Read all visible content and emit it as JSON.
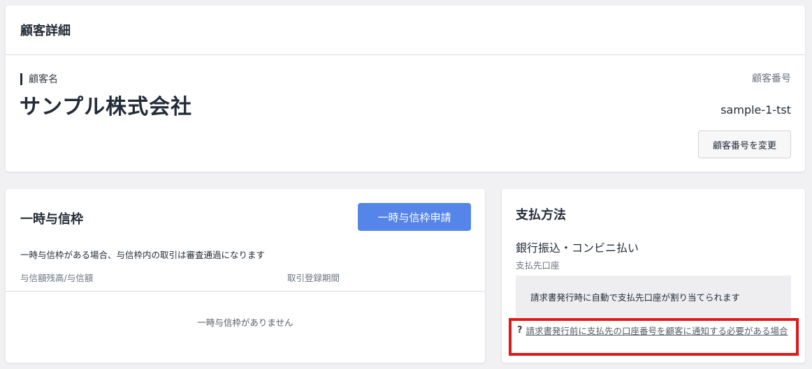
{
  "customer_detail": {
    "title": "顧客詳細",
    "name_label": "顧客名",
    "name": "サンプル株式会社",
    "number_label": "顧客番号",
    "number_value": "sample-1-tst",
    "change_number_button": "顧客番号を変更"
  },
  "temporary_credit": {
    "title": "一時与信枠",
    "apply_button": "一時与信枠申請",
    "description": "一時与信枠がある場合、与信枠内の取引は審査通過になります",
    "columns": [
      "与信額残高/与信額",
      "取引登録期間"
    ],
    "empty_message": "一時与信枠がありません",
    "accent_color": "#5585e8"
  },
  "payment_method": {
    "title": "支払方法",
    "method": "銀行振込・コンビニ払い",
    "account_label": "支払先口座",
    "auto_assign_note": "請求書発行時に自動で支払先口座が割り当てられます",
    "help_icon": "question-icon",
    "help_link": "請求書発行前に支払先の口座番号を顧客に通知する必要がある場合",
    "highlight_color": "#e01818"
  }
}
